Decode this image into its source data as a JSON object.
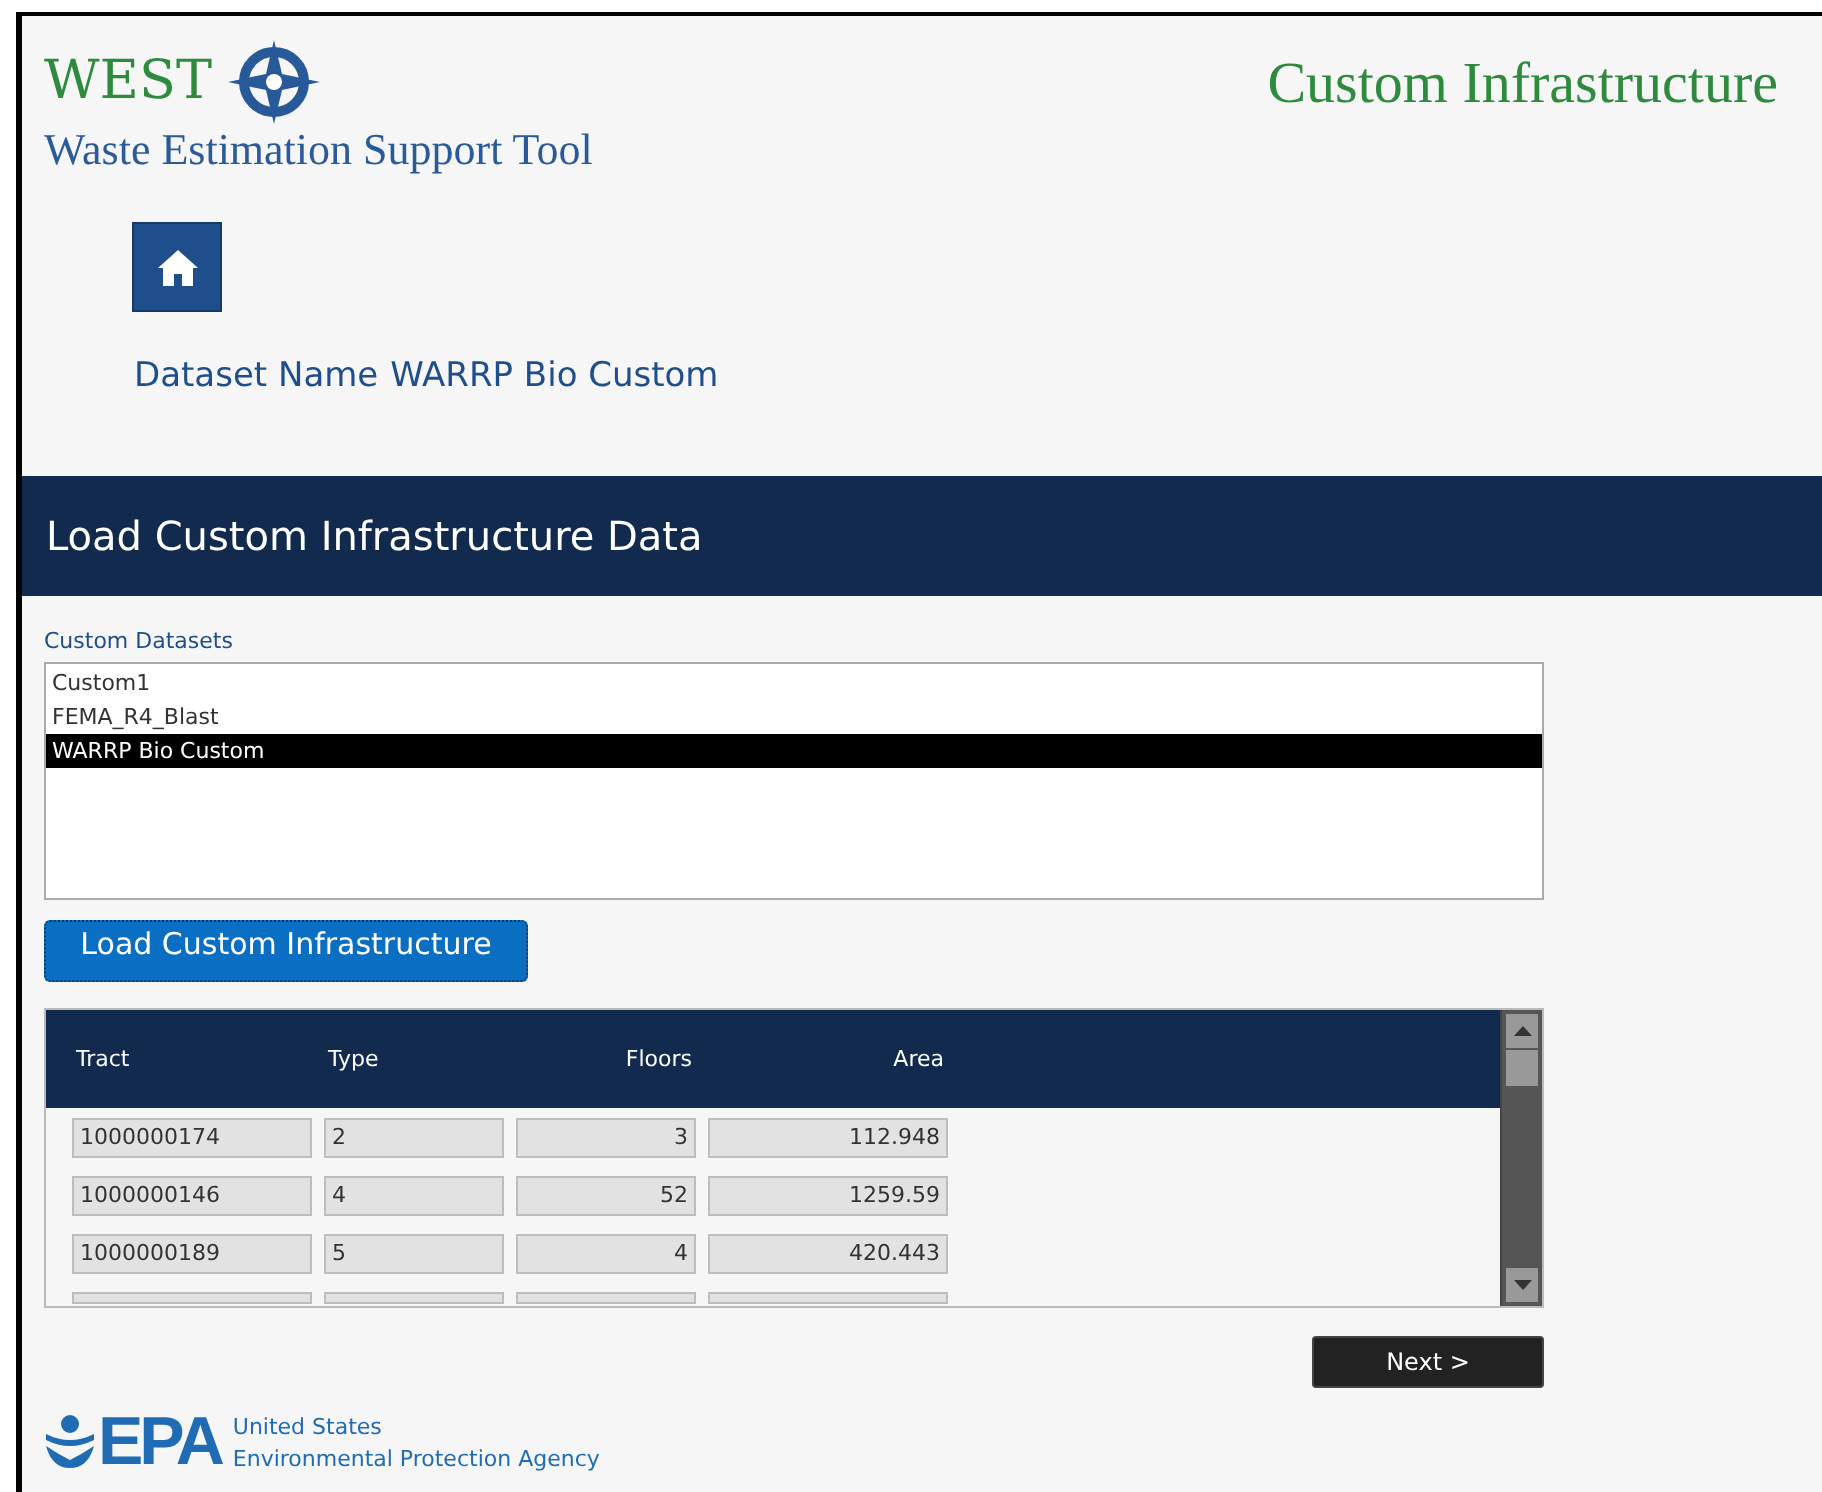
{
  "app": {
    "short_name": "WEST",
    "full_name": "Waste Estimation Support Tool",
    "page_title": "Custom Infrastructure"
  },
  "dataset": {
    "label": "Dataset Name",
    "value": "WARRP Bio Custom"
  },
  "banner": {
    "title": "Load Custom Infrastructure Data"
  },
  "datasets": {
    "label": "Custom Datasets",
    "items": [
      {
        "name": "Custom1",
        "selected": false
      },
      {
        "name": "FEMA_R4_Blast",
        "selected": false
      },
      {
        "name": "WARRP Bio Custom",
        "selected": true
      }
    ]
  },
  "load_button": "Load Custom Infrastructure",
  "table": {
    "columns": [
      {
        "label": "Tract",
        "kind": "text"
      },
      {
        "label": "Type",
        "kind": "text"
      },
      {
        "label": "Floors",
        "kind": "number"
      },
      {
        "label": "Area",
        "kind": "number"
      }
    ],
    "rows": [
      [
        "1000000174",
        "2",
        "3",
        "112.948"
      ],
      [
        "1000000146",
        "4",
        "52",
        "1259.59"
      ],
      [
        "1000000189",
        "5",
        "4",
        "420.443"
      ]
    ]
  },
  "next_button": "Next >",
  "footer": {
    "logo_text": "EPA",
    "line_1": "United States",
    "line_2": "Environmental Protection Agency"
  }
}
